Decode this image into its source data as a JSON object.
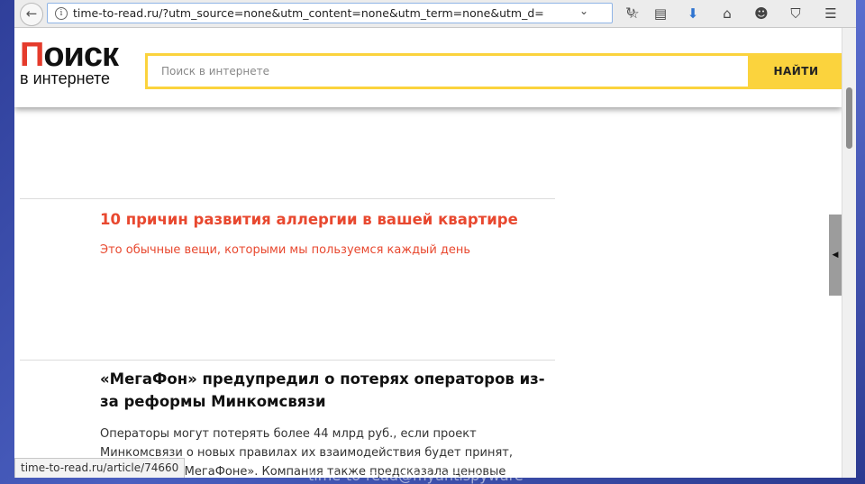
{
  "browser": {
    "url": "time-to-read.ru/?utm_source=none&utm_content=none&utm_term=none&utm_d=",
    "status_url": "time-to-read.ru/article/74660",
    "icons": [
      "back-arrow-icon",
      "info-icon",
      "dropdown-icon",
      "reload-icon",
      "star-icon",
      "reader-icon",
      "download-icon",
      "home-icon",
      "chat-icon",
      "pocket-icon",
      "menu-icon"
    ]
  },
  "site": {
    "logo_first_letter": "П",
    "logo_rest": "оиск",
    "logo_line2": "в интернете",
    "search_placeholder": "Поиск в интернете",
    "search_button": "НАЙТИ",
    "brand_color": "#fbd33d",
    "accent_color": "#e8482f"
  },
  "articles": [
    {
      "title": "10 причин развития аллергии в вашей квартире",
      "subtitle": "Это обычные вещи, которыми мы пользуемся каждый день"
    },
    {
      "title": "«МегаФон» предупредил о потерях операторов из-за реформы Минкомсвязи",
      "text": "Операторы могут потерять более 44 млрд руб., если проект Минкомсвязи о новых правилах их взаимодействия будет принят, сообщают в «МегаФоне». Компания также предсказала ценовые"
    }
  ],
  "watermark": "time-to-read@myantispyware"
}
